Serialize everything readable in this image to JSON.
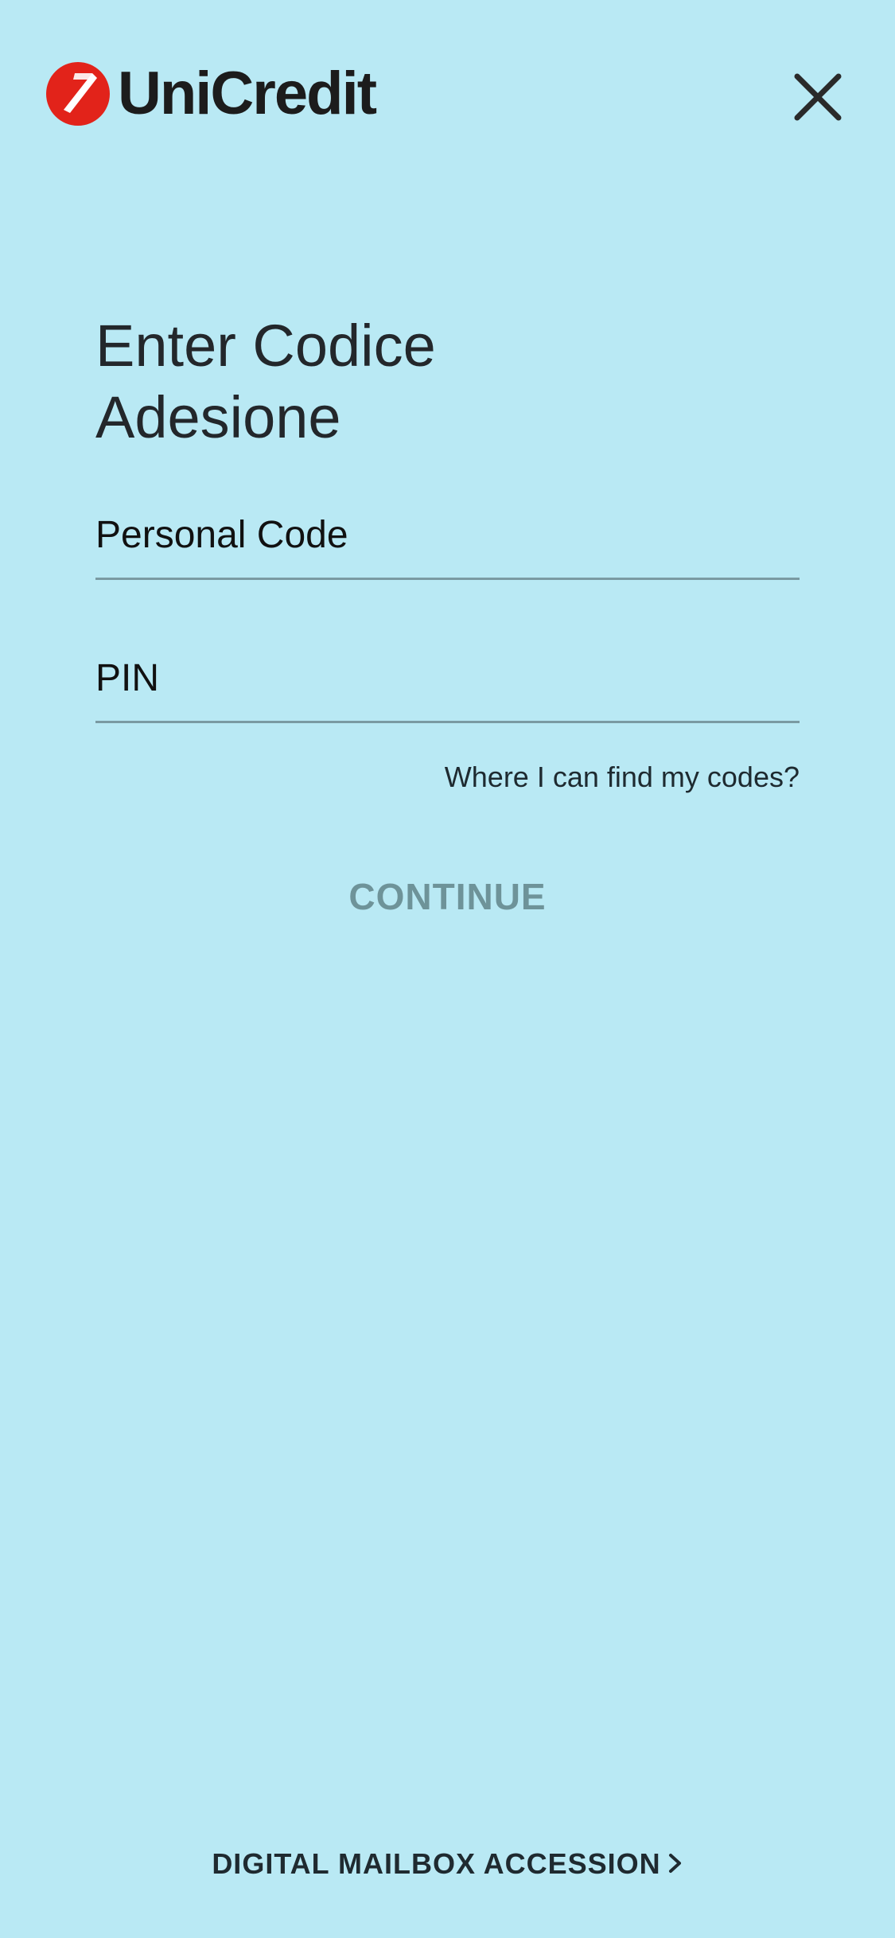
{
  "brand": {
    "name": "UniCredit",
    "accent_color": "#e2231a",
    "background_color": "#b9e9f4"
  },
  "header": {
    "close_icon": "close-icon"
  },
  "main": {
    "title": "Enter Codice Adesione",
    "personal_code_label": "Personal Code",
    "pin_label": "PIN",
    "help_link": "Where I can find my codes?",
    "continue_label": "CONTINUE"
  },
  "footer": {
    "mailbox_label": "DIGITAL MAILBOX ACCESSION",
    "chevron_icon": "chevron-right-icon"
  }
}
